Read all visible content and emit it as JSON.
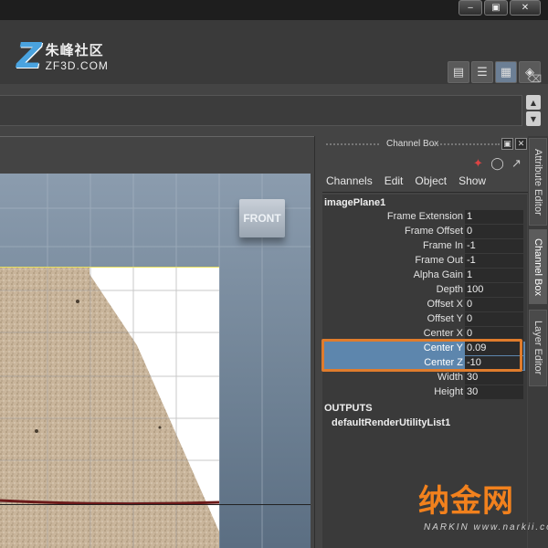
{
  "window_controls": {
    "minimize": "‒",
    "restore": "▣",
    "close": "✕"
  },
  "logo": {
    "mark": "Z",
    "cn": "朱峰社区",
    "en": "ZF3D.COM"
  },
  "viewport": {
    "view_cube_label": "FRONT"
  },
  "channel_box": {
    "title": "Channel Box",
    "menu": [
      "Channels",
      "Edit",
      "Object",
      "Show"
    ],
    "node": "imagePlane1",
    "attributes": [
      {
        "label": "Frame Extension",
        "value": "1"
      },
      {
        "label": "Frame Offset",
        "value": "0"
      },
      {
        "label": "Frame In",
        "value": "-1"
      },
      {
        "label": "Frame Out",
        "value": "-1"
      },
      {
        "label": "Alpha Gain",
        "value": "1"
      },
      {
        "label": "Depth",
        "value": "100"
      },
      {
        "label": "Offset X",
        "value": "0"
      },
      {
        "label": "Offset Y",
        "value": "0"
      },
      {
        "label": "Center X",
        "value": "0"
      },
      {
        "label": "Center Y",
        "value": "0.09"
      },
      {
        "label": "Center Z",
        "value": "-10"
      },
      {
        "label": "Width",
        "value": "30"
      },
      {
        "label": "Height",
        "value": "30"
      }
    ],
    "outputs_label": "OUTPUTS",
    "output_item": "defaultRenderUtilityList1"
  },
  "side_tabs": [
    "Attribute Editor",
    "Channel Box",
    "Layer Editor"
  ],
  "watermark": {
    "cn": "纳金网",
    "en": "NARKIN www.narkii.com"
  },
  "colors": {
    "highlight": "#e07c2c",
    "selection": "#5d86ad"
  }
}
